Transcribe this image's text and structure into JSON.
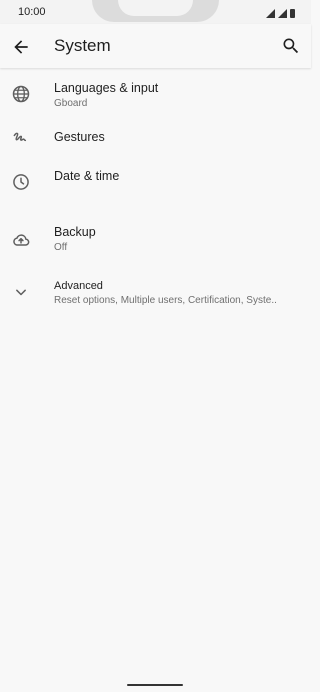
{
  "status_bar": {
    "time": "10:00"
  },
  "app_bar": {
    "title": "System"
  },
  "items": [
    {
      "label": "Languages & input",
      "sub": "Gboard",
      "icon": "globe-icon"
    },
    {
      "label": "Gestures",
      "sub": "",
      "icon": "gestures-icon"
    },
    {
      "label": "Date & time",
      "sub": "",
      "icon": "clock-icon"
    },
    {
      "label": "Backup",
      "sub": "Off",
      "icon": "cloud-upload-icon"
    },
    {
      "label": "Advanced",
      "sub": "Reset options, Multiple users, Certification, Syste..",
      "icon": "chevron-down-icon"
    }
  ]
}
